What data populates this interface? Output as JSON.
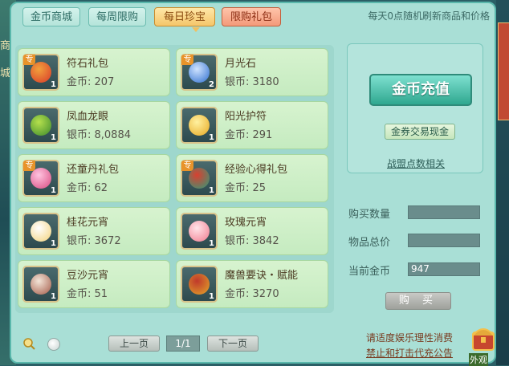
{
  "tabs": [
    {
      "label": "金币商城",
      "state": "normal"
    },
    {
      "label": "每周限购",
      "state": "normal"
    },
    {
      "label": "每日珍宝",
      "state": "active"
    },
    {
      "label": "限购礼包",
      "state": "red"
    }
  ],
  "notice": "每天0点随机刷新商品和价格",
  "items": [
    {
      "name": "符石礼包",
      "price": "金币: 207",
      "tag": "专",
      "count": "1",
      "icon": "red-gift-bag-icon"
    },
    {
      "name": "月光石",
      "price": "银币: 3180",
      "tag": "专",
      "count": "2",
      "icon": "blue-moonstone-icon"
    },
    {
      "name": "凤血龙眼",
      "price": "银币: 8,0884",
      "tag": "",
      "count": "1",
      "icon": "longan-fruit-icon"
    },
    {
      "name": "阳光护符",
      "price": "金币: 291",
      "tag": "",
      "count": "1",
      "icon": "sun-amulet-icon"
    },
    {
      "name": "还童丹礼包",
      "price": "金币: 62",
      "tag": "专",
      "count": "1",
      "icon": "pink-flower-bag-icon"
    },
    {
      "name": "经验心得礼包",
      "price": "金币: 25",
      "tag": "专",
      "count": "1",
      "icon": "green-book-bag-icon"
    },
    {
      "name": "桂花元宵",
      "price": "银币: 3672",
      "tag": "",
      "count": "1",
      "icon": "osmanthus-dumplings-icon"
    },
    {
      "name": "玫瑰元宵",
      "price": "银币: 3842",
      "tag": "",
      "count": "1",
      "icon": "rose-dumplings-icon"
    },
    {
      "name": "豆沙元宵",
      "price": "金币: 51",
      "tag": "",
      "count": "1",
      "icon": "bean-paste-dumplings-icon"
    },
    {
      "name": "魔兽要诀・赋能",
      "price": "金币: 3270",
      "tag": "",
      "count": "1",
      "icon": "golden-helmet-icon"
    }
  ],
  "side": {
    "recharge": "金币充值",
    "exchange": "金券交易现金",
    "alliance": "战盟点数相关"
  },
  "form": {
    "qty_label": "购买数量",
    "qty_value": "",
    "total_label": "物品总价",
    "total_value": "",
    "balance_label": "当前金币",
    "balance_value": "947",
    "buy": "购 买"
  },
  "pager": {
    "prev": "上一页",
    "indicator": "1/1",
    "next": "下一页"
  },
  "footer": {
    "line1": "请适度娱乐理性消费",
    "line2": "禁止和打击代充公告"
  },
  "edge": {
    "left_fragments": [
      "商",
      "城"
    ],
    "chest_label": "外观"
  },
  "colors": {
    "panel": "#a9dfd6",
    "accent": "#2fa78f",
    "active_tab": "#f5c66a"
  }
}
